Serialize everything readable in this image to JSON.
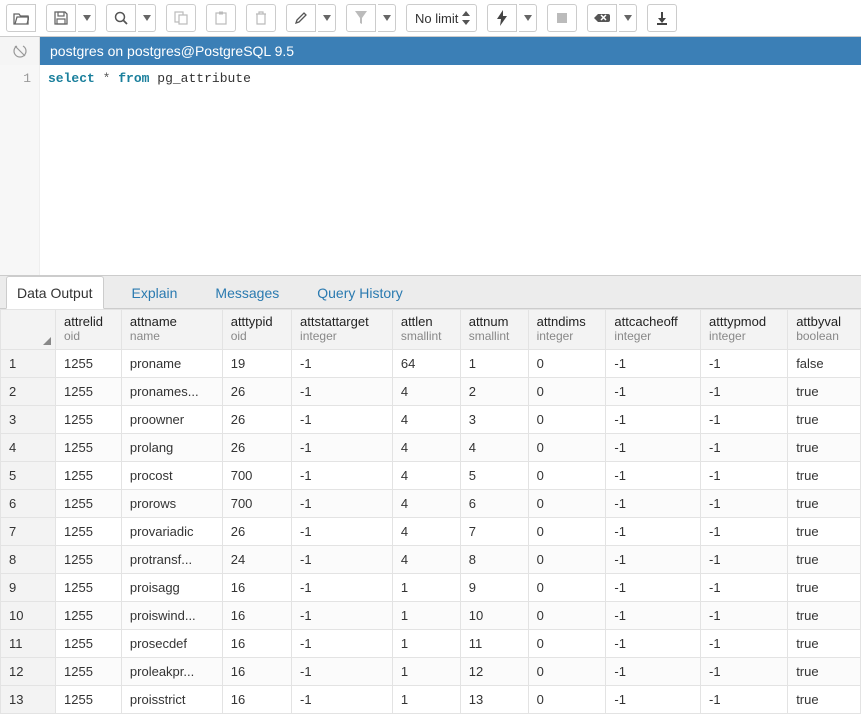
{
  "toolbar": {
    "limit_label": "No limit"
  },
  "connection": {
    "label": "postgres on postgres@PostgreSQL 9.5"
  },
  "editor": {
    "line_number": "1",
    "kw_select": "select",
    "star": "*",
    "kw_from": "from",
    "ident": "pg_attribute"
  },
  "tabs": {
    "data_output": "Data Output",
    "explain": "Explain",
    "messages": "Messages",
    "query_history": "Query History"
  },
  "columns": [
    {
      "name": "attrelid",
      "type": "oid",
      "align": "left"
    },
    {
      "name": "attname",
      "type": "name",
      "align": "left"
    },
    {
      "name": "atttypid",
      "type": "oid",
      "align": "left"
    },
    {
      "name": "attstattarget",
      "type": "integer",
      "align": "right"
    },
    {
      "name": "attlen",
      "type": "smallint",
      "align": "right"
    },
    {
      "name": "attnum",
      "type": "smallint",
      "align": "right"
    },
    {
      "name": "attndims",
      "type": "integer",
      "align": "right"
    },
    {
      "name": "attcacheoff",
      "type": "integer",
      "align": "right"
    },
    {
      "name": "atttypmod",
      "type": "integer",
      "align": "right"
    },
    {
      "name": "attbyval",
      "type": "boolean",
      "align": "left"
    }
  ],
  "rows": [
    [
      "1255",
      "proname",
      "19",
      "-1",
      "64",
      "1",
      "0",
      "-1",
      "-1",
      "false"
    ],
    [
      "1255",
      "pronames...",
      "26",
      "-1",
      "4",
      "2",
      "0",
      "-1",
      "-1",
      "true"
    ],
    [
      "1255",
      "proowner",
      "26",
      "-1",
      "4",
      "3",
      "0",
      "-1",
      "-1",
      "true"
    ],
    [
      "1255",
      "prolang",
      "26",
      "-1",
      "4",
      "4",
      "0",
      "-1",
      "-1",
      "true"
    ],
    [
      "1255",
      "procost",
      "700",
      "-1",
      "4",
      "5",
      "0",
      "-1",
      "-1",
      "true"
    ],
    [
      "1255",
      "prorows",
      "700",
      "-1",
      "4",
      "6",
      "0",
      "-1",
      "-1",
      "true"
    ],
    [
      "1255",
      "provariadic",
      "26",
      "-1",
      "4",
      "7",
      "0",
      "-1",
      "-1",
      "true"
    ],
    [
      "1255",
      "protransf...",
      "24",
      "-1",
      "4",
      "8",
      "0",
      "-1",
      "-1",
      "true"
    ],
    [
      "1255",
      "proisagg",
      "16",
      "-1",
      "1",
      "9",
      "0",
      "-1",
      "-1",
      "true"
    ],
    [
      "1255",
      "proiswind...",
      "16",
      "-1",
      "1",
      "10",
      "0",
      "-1",
      "-1",
      "true"
    ],
    [
      "1255",
      "prosecdef",
      "16",
      "-1",
      "1",
      "11",
      "0",
      "-1",
      "-1",
      "true"
    ],
    [
      "1255",
      "proleakpr...",
      "16",
      "-1",
      "1",
      "12",
      "0",
      "-1",
      "-1",
      "true"
    ],
    [
      "1255",
      "proisstrict",
      "16",
      "-1",
      "1",
      "13",
      "0",
      "-1",
      "-1",
      "true"
    ]
  ]
}
